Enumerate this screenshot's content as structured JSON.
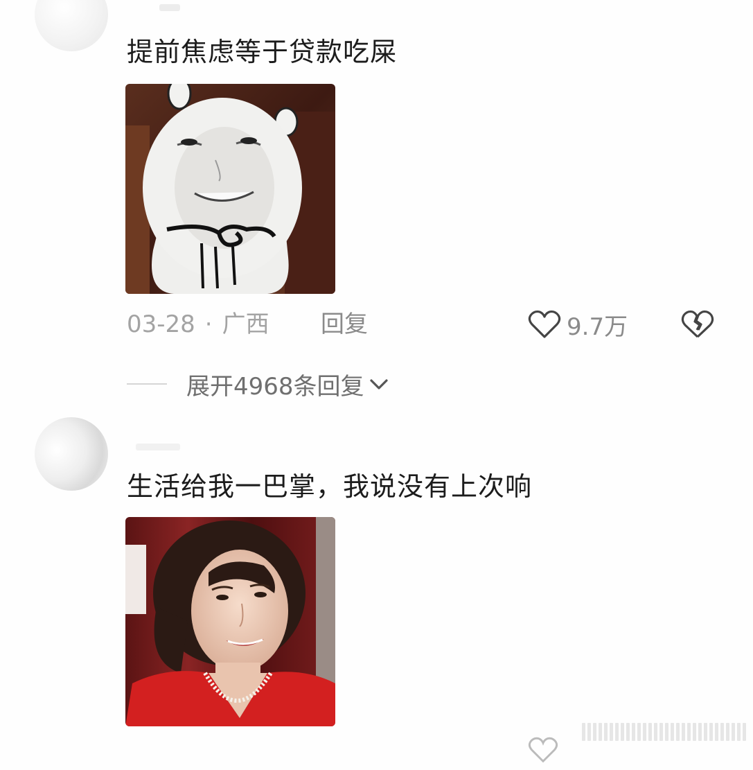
{
  "comments": [
    {
      "text": "提前焦虑等于贷款吃屎",
      "date": "03-28",
      "location": "广西",
      "reply_label": "回复",
      "likes": "9.7万",
      "expand_label": "展开4968条回复",
      "image": "bunny-meme-face-sticker"
    },
    {
      "text": "生活给我一巴掌，我说没有上次响",
      "image": "smiling-woman-red-jacket-photo"
    }
  ],
  "icons": {
    "like": "heart-outline-icon",
    "dislike": "broken-heart-icon",
    "expand": "chevron-down-icon"
  },
  "colors": {
    "text_primary": "#1c1c1c",
    "text_meta": "#a3a3a3",
    "text_secondary": "#8a8a8a",
    "background": "#fefefe"
  }
}
